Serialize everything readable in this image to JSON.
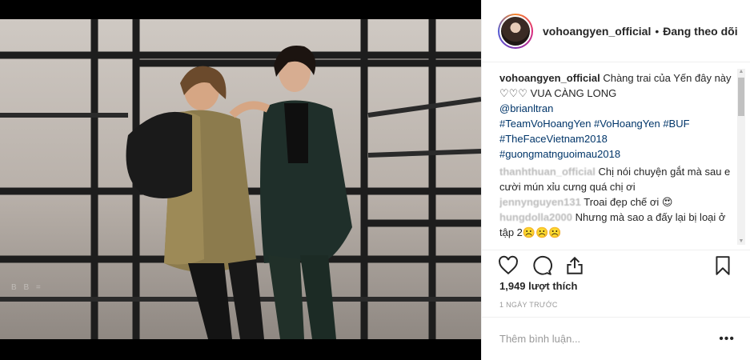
{
  "post": {
    "username": "vohoangyen_official",
    "separator": "•",
    "follow_status": "Đang theo dõi",
    "photo_watermark": "B B ="
  },
  "caption": {
    "user": "vohoangyen_official",
    "text": "Chàng trai của Yến đây này ♡♡♡ VUA CÀNG LONG",
    "mention": "@brianltran",
    "hashtags_line1": "#TeamVoHoangYen #VoHoangYen #BUF",
    "hashtags_line2": "#TheFaceVietnam2018",
    "hashtags_line3": "#guongmatnguoimau2018"
  },
  "comments": [
    {
      "user": "thanhthuan_official",
      "text": "Chị nói chuyện gắt mà sau e cười mún xỉu cưng quá chị ơi"
    },
    {
      "user": "jennynguyen131",
      "text": "Troai đẹp chế ơi 😍"
    },
    {
      "user": "hungdolla2000",
      "text": "Nhưng mà sao a đấy lại bị loại ở tập 2☹️☹️☹️"
    }
  ],
  "stats": {
    "likes": "1,949 lượt thích",
    "time": "1 NGÀY TRƯỚC"
  },
  "add_comment": {
    "placeholder": "Thêm bình luận...",
    "more": "•••"
  },
  "icons": {
    "like": "heart-icon",
    "comment": "comment-icon",
    "share": "share-icon",
    "save": "bookmark-icon"
  },
  "colors": {
    "link": "#003569",
    "text": "#262626",
    "muted": "#999999"
  }
}
